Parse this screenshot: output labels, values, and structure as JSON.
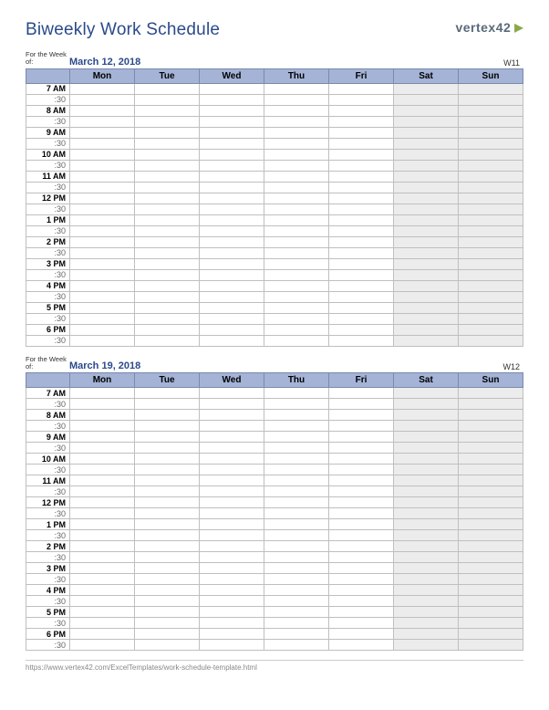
{
  "title": "Biweekly Work Schedule",
  "logo_text": "vertex42",
  "week_label": "For the Week of:",
  "days": [
    "Mon",
    "Tue",
    "Wed",
    "Thu",
    "Fri",
    "Sat",
    "Sun"
  ],
  "weekend_indices": [
    5,
    6
  ],
  "hours": [
    "7 AM",
    "8 AM",
    "9 AM",
    "10 AM",
    "11 AM",
    "12 PM",
    "1 PM",
    "2 PM",
    "3 PM",
    "4 PM",
    "5 PM",
    "6 PM"
  ],
  "half_label": ":30",
  "weeks": [
    {
      "date": "March 12, 2018",
      "week_num": "W11"
    },
    {
      "date": "March 19, 2018",
      "week_num": "W12"
    }
  ],
  "footer_url": "https://www.vertex42.com/ExcelTemplates/work-schedule-template.html"
}
